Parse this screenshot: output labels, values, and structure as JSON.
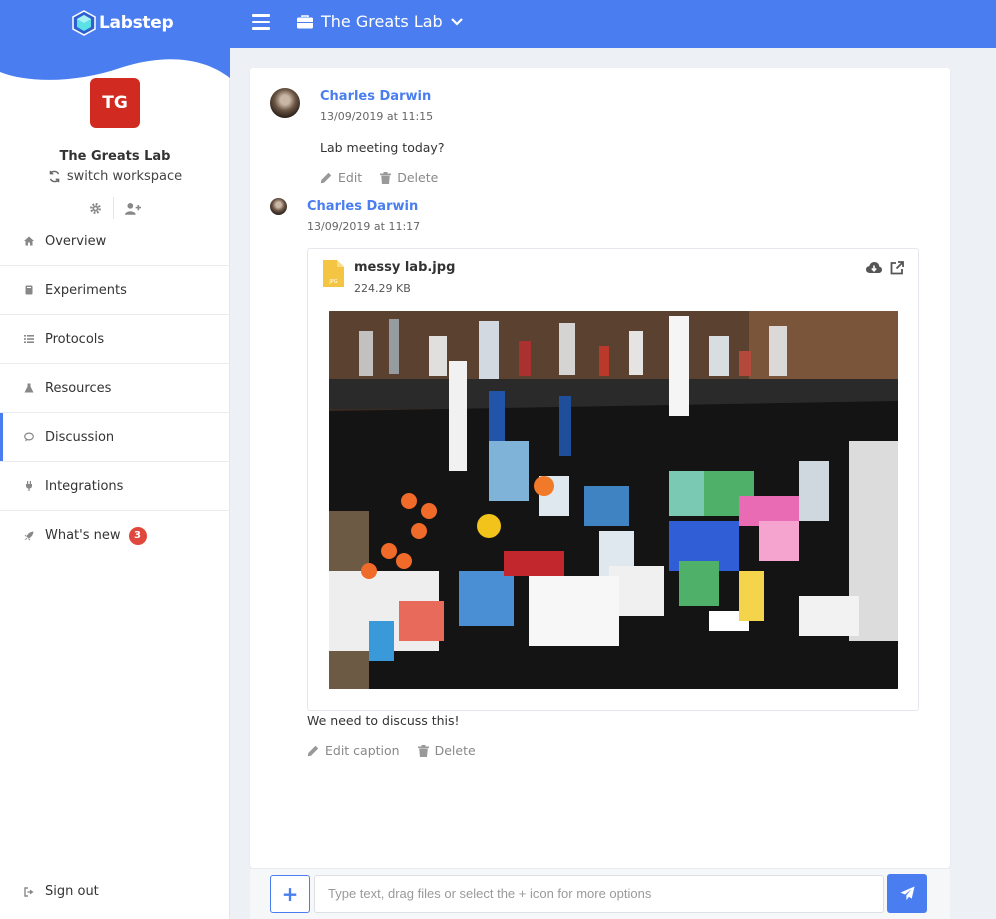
{
  "brand": {
    "name": "Labstep",
    "color": "#4a7ef0"
  },
  "workspace": {
    "initials": "TG",
    "name": "The Greats Lab",
    "switch_label": "switch workspace",
    "avatar_color": "#d02a21"
  },
  "nav": {
    "items": [
      {
        "label": "Overview",
        "icon": "home-icon"
      },
      {
        "label": "Experiments",
        "icon": "book-icon"
      },
      {
        "label": "Protocols",
        "icon": "list-icon"
      },
      {
        "label": "Resources",
        "icon": "flask-icon"
      },
      {
        "label": "Discussion",
        "icon": "chat-icon",
        "active": true
      },
      {
        "label": "Integrations",
        "icon": "plug-icon"
      },
      {
        "label": "What's new",
        "icon": "rocket-icon",
        "badge": "3"
      }
    ],
    "signout_label": "Sign out"
  },
  "topbar": {
    "title": "The Greats Lab"
  },
  "thread": {
    "comment1": {
      "author": "Charles Darwin",
      "time": "13/09/2019 at 11:15",
      "text": "Lab meeting today?",
      "edit_label": "Edit",
      "delete_label": "Delete"
    },
    "comment2": {
      "author": "Charles Darwin",
      "time": "13/09/2019 at 11:17",
      "file": {
        "name": "messy lab.jpg",
        "size": "224.29 KB",
        "type_label": "JPG"
      },
      "caption": "We need to discuss this!",
      "edit_label": "Edit caption",
      "delete_label": "Delete"
    }
  },
  "composer": {
    "placeholder": "Type text, drag files or select the + icon for more options",
    "plus_label": "+"
  }
}
